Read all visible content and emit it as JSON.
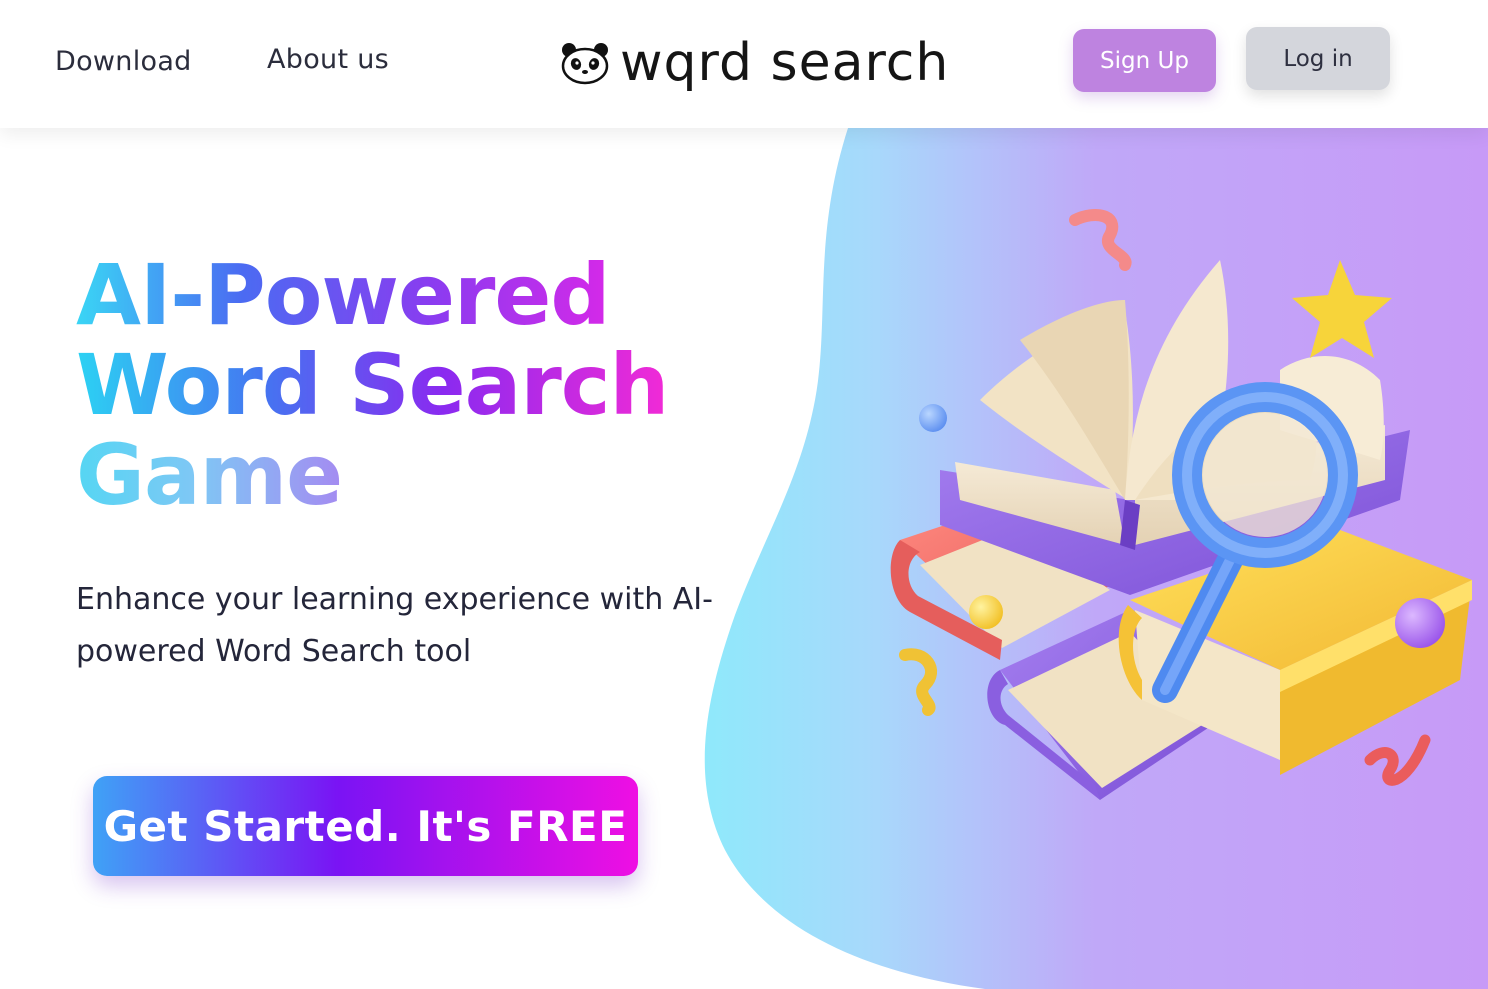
{
  "header": {
    "nav": {
      "download_label": "Download",
      "about_label": "About us"
    },
    "logo_text": "wqrd search",
    "signup_label": "Sign Up",
    "login_label": "Log in"
  },
  "hero": {
    "title_line_1": "AI-Powered",
    "title_line_2": "Word Search",
    "title_line_3": "Game",
    "subtitle": "Enhance your learning experience with AI-powered Word Search tool",
    "cta_label": "Get Started. It's FREE"
  },
  "colors": {
    "signup_bg": "#be83e0",
    "login_bg": "#d4d6dc",
    "blob_start": "#8fe9fb",
    "blob_end": "#c59bf7",
    "cta_start": "#3fa2f6",
    "cta_mid": "#7a13f4",
    "cta_end": "#ef0fe3"
  },
  "icons": {
    "logo_icon": "panda-icon",
    "illustration": "books-magnifier-illustration"
  }
}
